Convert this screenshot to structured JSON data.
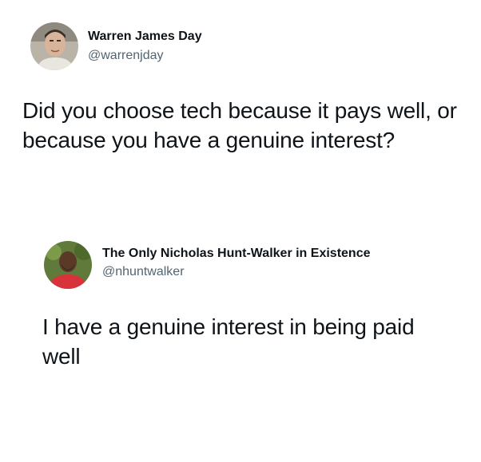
{
  "tweet1": {
    "author_name": "Warren James Day",
    "author_handle": "@warrenjday",
    "text": "Did you choose tech because it pays well, or because you have a genuine interest?"
  },
  "tweet2": {
    "author_name": "The Only Nicholas Hunt-Walker in Existence",
    "author_handle": "@nhuntwalker",
    "text": "I have a genuine interest in being paid well"
  },
  "colors": {
    "text_primary": "#0f1419",
    "text_secondary": "#536471",
    "background": "#ffffff"
  }
}
